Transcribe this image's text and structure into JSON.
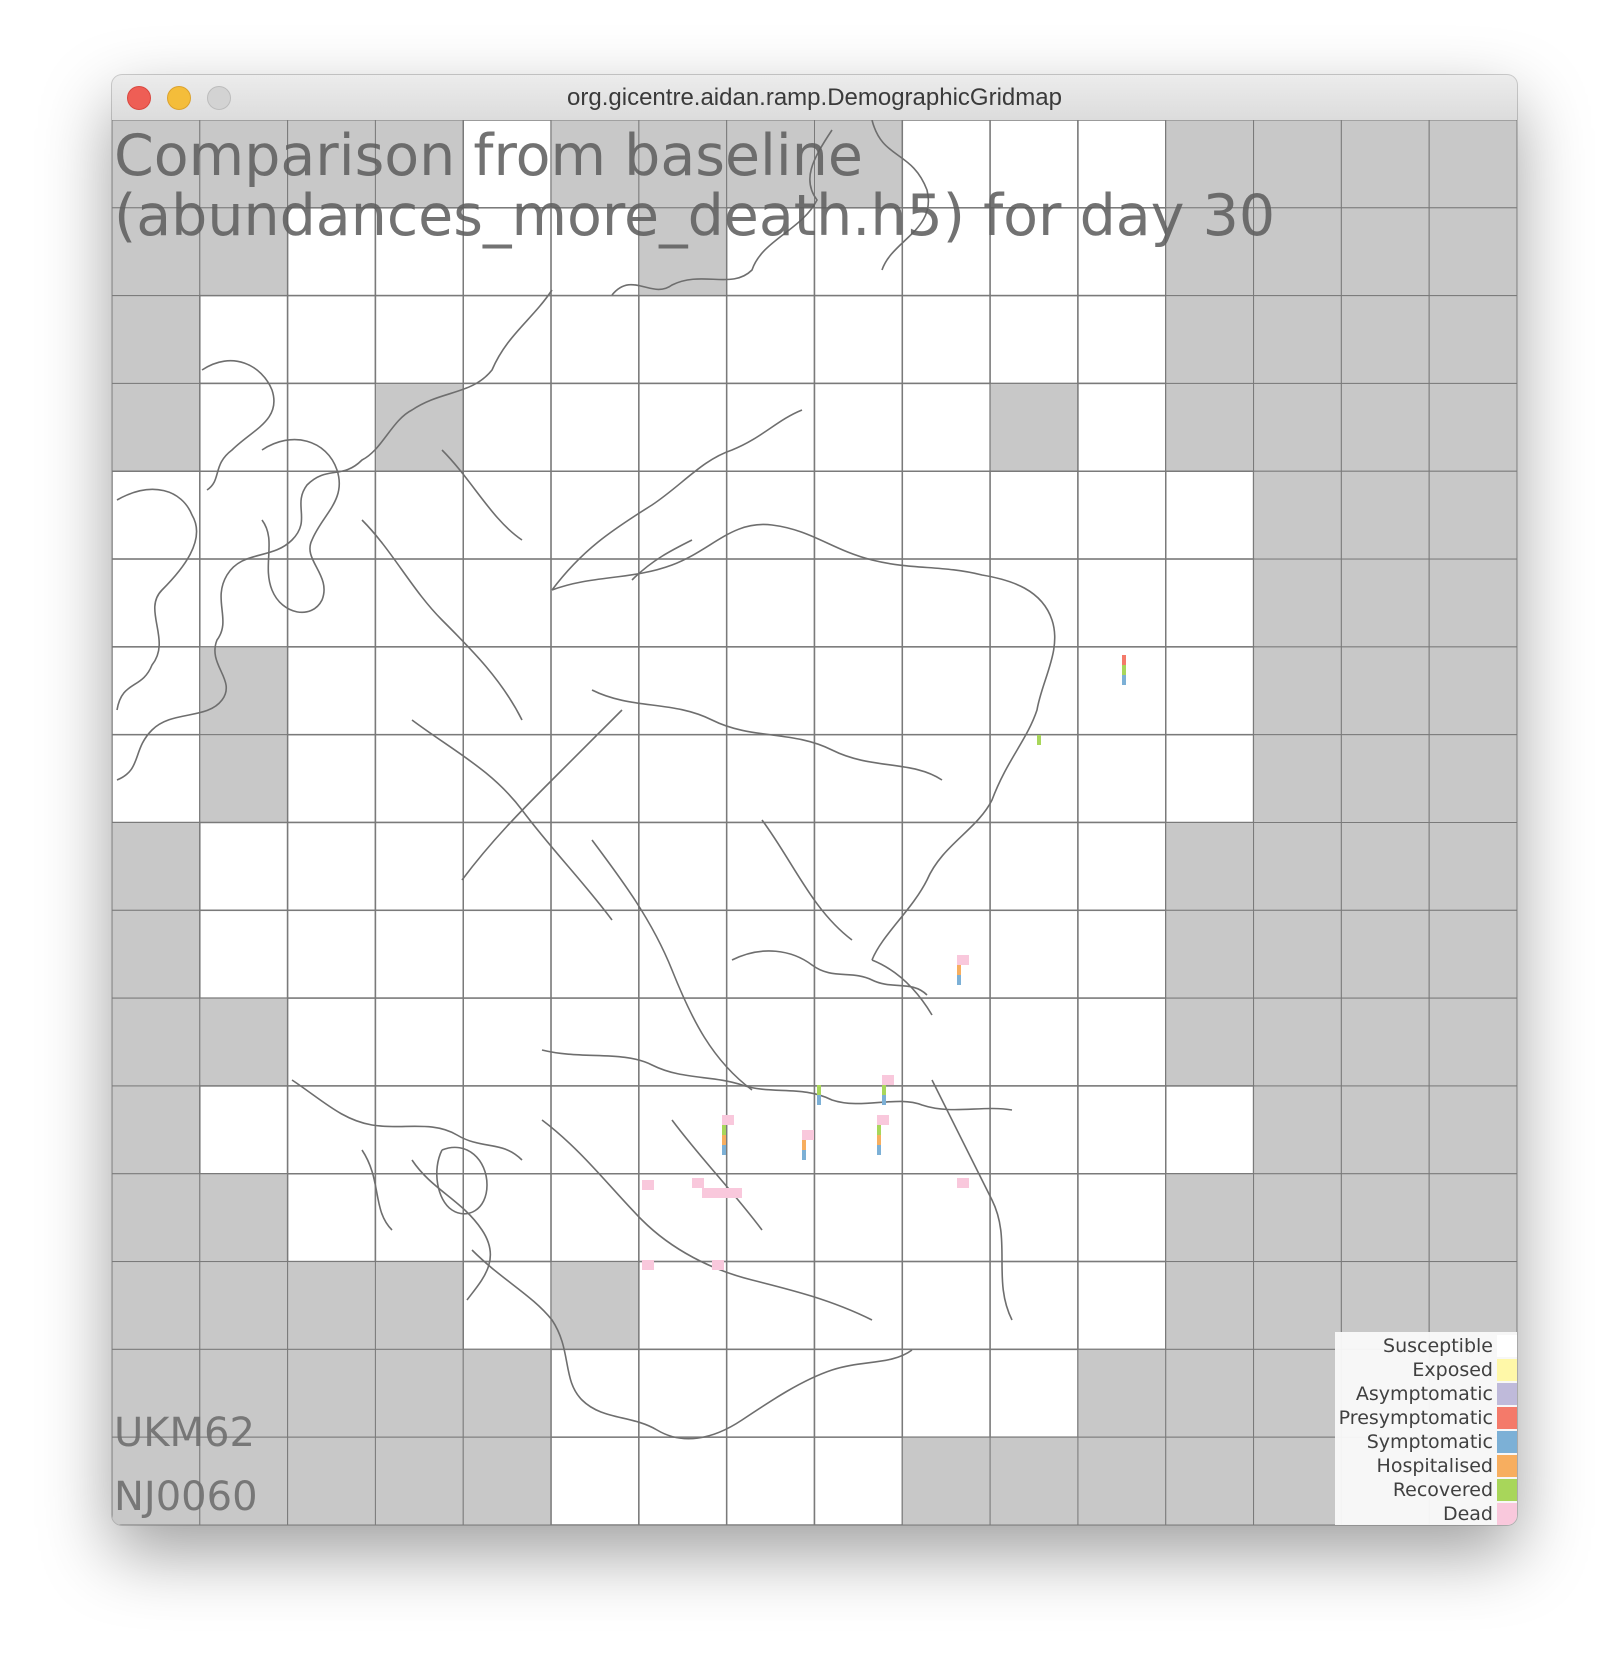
{
  "window": {
    "title": "org.gicentre.aidan.ramp.DemographicGridmap"
  },
  "map": {
    "title_line1": "Comparison from baseline",
    "title_line2": "(abundances_more_death.h5) for day 30",
    "region_code": "UKM62",
    "cell_code": "NJ0060",
    "grid_columns": 16,
    "grid_rows": 16
  },
  "legend": {
    "items": [
      {
        "label": "Susceptible",
        "color": "#ffffff"
      },
      {
        "label": "Exposed",
        "color": "#fff8a8"
      },
      {
        "label": "Asymptomatic",
        "color": "#bfbada"
      },
      {
        "label": "Presymptomatic",
        "color": "#f47a6a"
      },
      {
        "label": "Symptomatic",
        "color": "#7cb0d6"
      },
      {
        "label": "Hospitalised",
        "color": "#f7ae5f"
      },
      {
        "label": "Recovered",
        "color": "#a8d65a"
      },
      {
        "label": "Dead",
        "color": "#f9c8dc"
      }
    ]
  },
  "colors": {
    "land_cell": "#ffffff",
    "empty_cell": "#c8c8c8",
    "grid_line": "#7a7a7a",
    "coastline": "#6e6e6e"
  }
}
